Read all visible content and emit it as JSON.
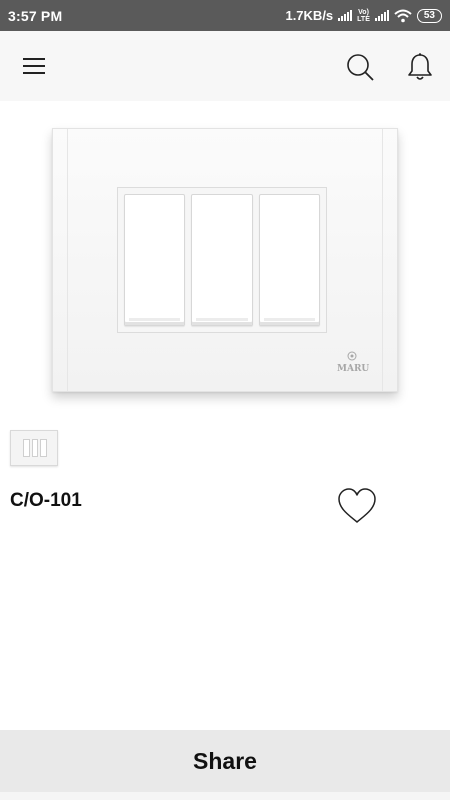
{
  "status_bar": {
    "time": "3:57 PM",
    "network_speed": "1.7KB/s",
    "volte_top": "Vo)",
    "volte_bottom": "LTE",
    "battery": "53"
  },
  "app_bar": {
    "icons": [
      "menu-icon",
      "search-icon",
      "bell-icon"
    ]
  },
  "product": {
    "brand_logo": "MARU",
    "code": "C/O-101",
    "switch_count": 3
  },
  "share_button": {
    "label": "Share"
  },
  "colors": {
    "status_bar": "#5a5a5a",
    "app_bar": "#f7f7f7",
    "share_bar": "#e9e9e9"
  }
}
